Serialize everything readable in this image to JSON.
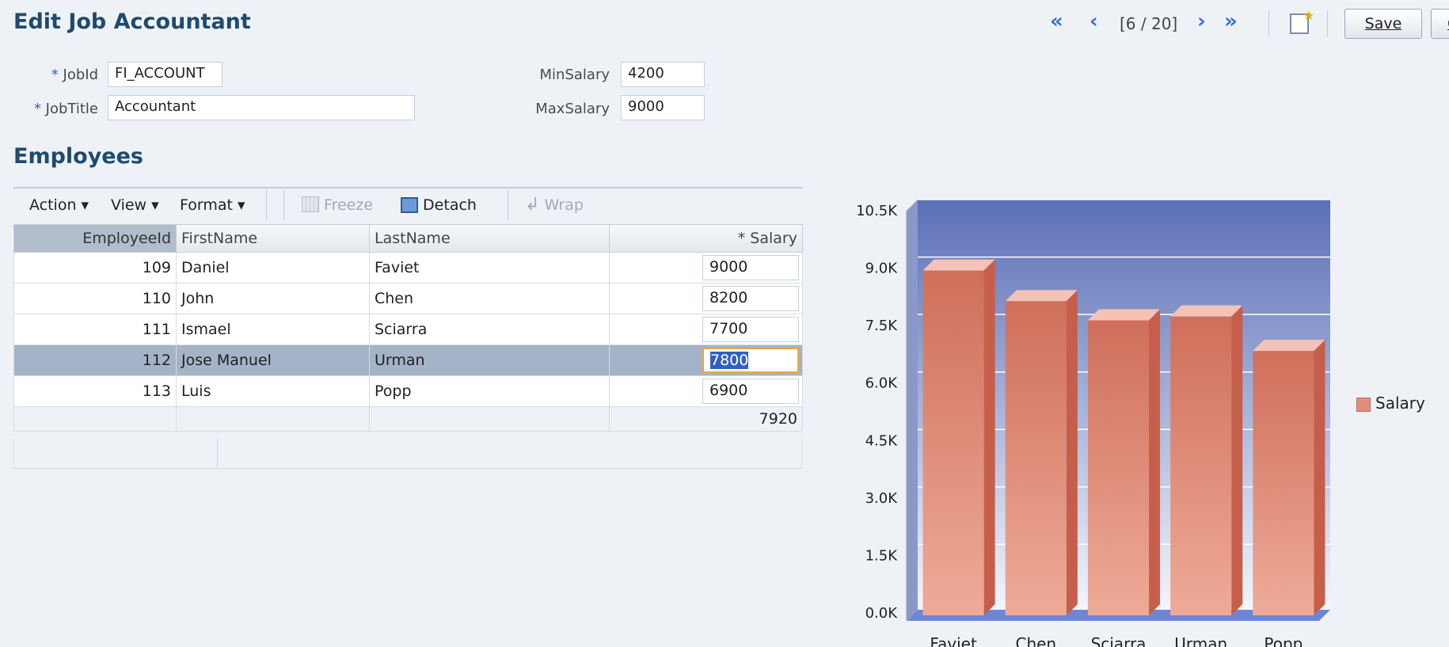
{
  "page": {
    "title": "Edit Job Accountant",
    "section_title": "Employees"
  },
  "nav": {
    "first_icon": "double-chevron-left-icon",
    "prev_icon": "chevron-left-icon",
    "pager": "[6 / 20]",
    "next_icon": "chevron-right-icon",
    "last_icon": "double-chevron-right-icon",
    "new_icon": "new-record-icon",
    "save_label": "Save",
    "cancel_label": "Cancel"
  },
  "form": {
    "jobid_label": "JobId",
    "jobid_value": "FI_ACCOUNT",
    "jobtitle_label": "JobTitle",
    "jobtitle_value": "Accountant",
    "minsalary_label": "MinSalary",
    "minsalary_value": "4200",
    "maxsalary_label": "MaxSalary",
    "maxsalary_value": "9000",
    "required_marker": "*"
  },
  "toolbar": {
    "action": "Action ▾",
    "view": "View ▾",
    "format": "Format ▾",
    "freeze": "Freeze",
    "detach": "Detach",
    "wrap": "Wrap"
  },
  "table": {
    "headers": [
      "EmployeeId",
      "FirstName",
      "LastName",
      "* Salary"
    ],
    "rows": [
      {
        "id": "109",
        "first": "Daniel",
        "last": "Faviet",
        "salary": "9000"
      },
      {
        "id": "110",
        "first": "John",
        "last": "Chen",
        "salary": "8200"
      },
      {
        "id": "111",
        "first": "Ismael",
        "last": "Sciarra",
        "salary": "7700"
      },
      {
        "id": "112",
        "first": "Jose Manuel",
        "last": "Urman",
        "salary": "7800"
      },
      {
        "id": "113",
        "first": "Luis",
        "last": "Popp",
        "salary": "6900"
      }
    ],
    "selected_row": 3,
    "total": "7920"
  },
  "colors": {
    "bar": "#e08f7a",
    "plot_top": "#5b6fb7",
    "plot_bottom": "#f3f5fb",
    "selected_row": "#a5b3c8",
    "title": "#1e4a6e"
  },
  "chart_data": {
    "type": "bar",
    "categories": [
      "Faviet",
      "Chen",
      "Sciarra",
      "Urman",
      "Popp"
    ],
    "series": [
      {
        "name": "Salary",
        "values": [
          9000,
          8200,
          7700,
          7800,
          6900
        ]
      }
    ],
    "yticks": [
      "0.0K",
      "1.5K",
      "3.0K",
      "4.5K",
      "6.0K",
      "7.5K",
      "9.0K",
      "10.5K"
    ],
    "ylim": [
      0,
      10500
    ],
    "legend": "right",
    "grid": true,
    "style": "3d"
  }
}
